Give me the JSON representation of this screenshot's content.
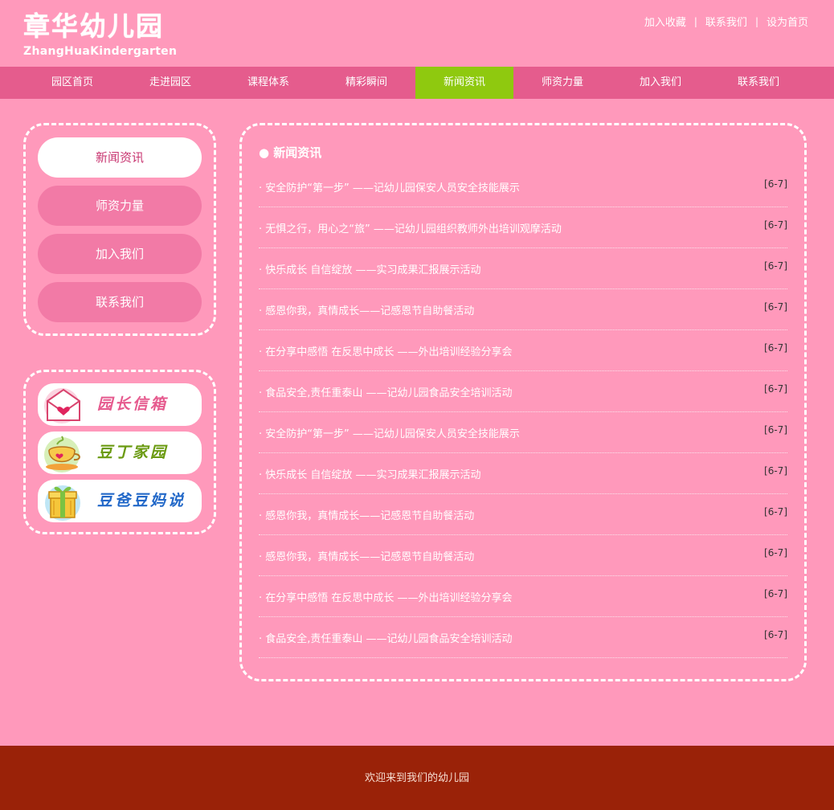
{
  "logo": {
    "cn": "章华幼儿园",
    "en": "ZhangHuaKindergarten"
  },
  "toplinks": [
    "加入收藏",
    "联系我们",
    "设为首页"
  ],
  "toplink_separator": "|",
  "nav": {
    "items": [
      "园区首页",
      "走进园区",
      "课程体系",
      "精彩瞬间",
      "新闻资讯",
      "师资力量",
      "加入我们",
      "联系我们"
    ],
    "active_index": 4,
    "active_color": "#8fc90f",
    "bar_color": "#e55c8d"
  },
  "sidebar": {
    "menu": [
      "新闻资讯",
      "师资力量",
      "加入我们",
      "联系我们"
    ],
    "active_index": 0,
    "links": [
      {
        "label": "园长信箱",
        "icon": "envelope-heart-icon",
        "color": "#e65a8e"
      },
      {
        "label": "豆丁家园",
        "icon": "teacup-icon",
        "color": "#6a9a10"
      },
      {
        "label": "豆爸豆妈说",
        "icon": "gift-box-icon",
        "color": "#2268c8"
      }
    ]
  },
  "news": {
    "title": "● 新闻资讯",
    "items": [
      {
        "title": "· 安全防护“第一步” ——记幼儿园保安人员安全技能展示",
        "date": "[6-7]"
      },
      {
        "title": "· 无惧之行，用心之“旅” ——记幼儿园组织教师外出培训观摩活动",
        "date": "[6-7]"
      },
      {
        "title": "· 快乐成长 自信绽放 ——实习成果汇报展示活动",
        "date": "[6-7]"
      },
      {
        "title": "· 感恩你我，真情成长——记感恩节自助餐活动",
        "date": "[6-7]"
      },
      {
        "title": "· 在分享中感悟 在反思中成长 ——外出培训经验分享会",
        "date": "[6-7]"
      },
      {
        "title": "· 食品安全,责任重泰山 ——记幼儿园食品安全培训活动",
        "date": "[6-7]"
      },
      {
        "title": "· 安全防护“第一步” ——记幼儿园保安人员安全技能展示",
        "date": "[6-7]"
      },
      {
        "title": "· 快乐成长 自信绽放 ——实习成果汇报展示活动",
        "date": "[6-7]"
      },
      {
        "title": "· 感恩你我，真情成长——记感恩节自助餐活动",
        "date": "[6-7]"
      },
      {
        "title": "· 感恩你我，真情成长——记感恩节自助餐活动",
        "date": "[6-7]"
      },
      {
        "title": "· 在分享中感悟 在反思中成长 ——外出培训经验分享会",
        "date": "[6-7]"
      },
      {
        "title": "· 食品安全,责任重泰山 ——记幼儿园食品安全培训活动",
        "date": "[6-7]"
      }
    ]
  },
  "footer": {
    "text": "欢迎来到我们的幼儿园",
    "bg": "#9a2208"
  },
  "colors": {
    "page_bg": "#ff99bb",
    "side_button": "#f27aa6"
  }
}
